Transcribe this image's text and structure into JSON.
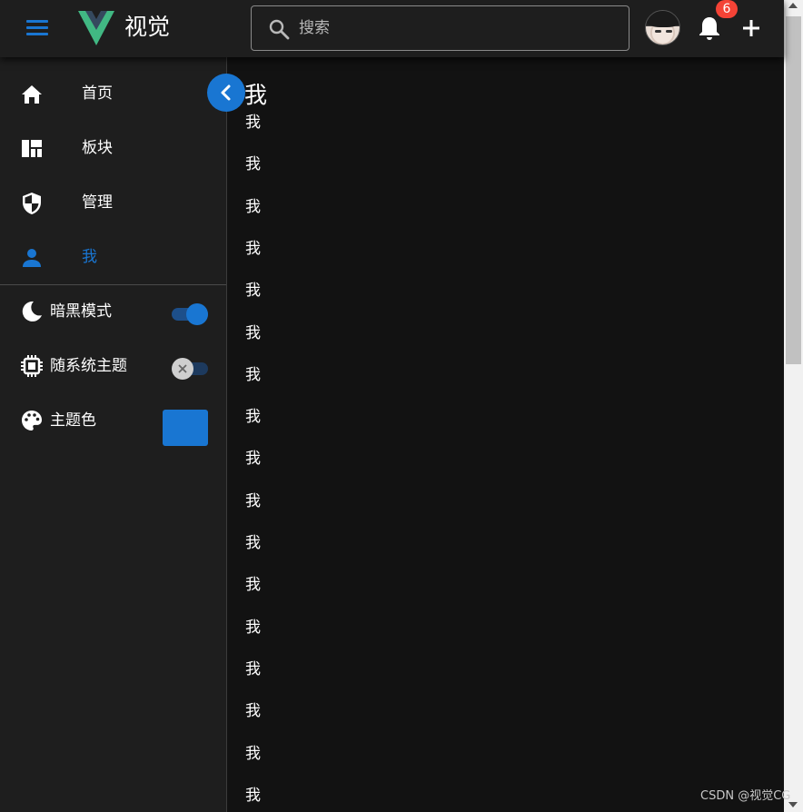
{
  "header": {
    "brand": "视觉",
    "search_placeholder": "搜索",
    "notification_count": "6"
  },
  "sidebar": {
    "nav": [
      {
        "label": "首页",
        "icon": "home-icon"
      },
      {
        "label": "板块",
        "icon": "dashboard-icon"
      },
      {
        "label": "管理",
        "icon": "shield-icon"
      },
      {
        "label": "我",
        "icon": "person-icon",
        "active": true
      }
    ],
    "settings": {
      "dark_mode_label": "暗黑模式",
      "dark_mode_on": true,
      "follow_system_label": "随系统主题",
      "follow_system_on": false,
      "theme_color_label": "主题色",
      "theme_color": "#1976d2"
    }
  },
  "main": {
    "title": "我",
    "lines": [
      "我",
      "我",
      "我",
      "我",
      "我",
      "我",
      "我",
      "我",
      "我",
      "我",
      "我",
      "我",
      "我",
      "我",
      "我",
      "我",
      "我"
    ]
  },
  "watermark": "CSDN @视觉CG",
  "colors": {
    "accent": "#1976d2",
    "background": "#121212",
    "surface": "#1e1e1e",
    "badge": "#f44336"
  }
}
